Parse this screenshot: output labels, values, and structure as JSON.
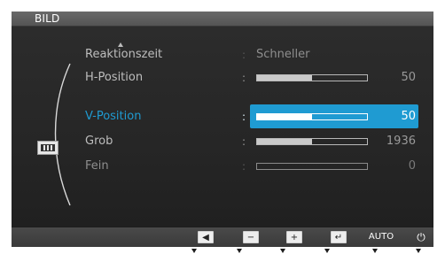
{
  "osd": {
    "title": "BILD",
    "category_icon": "picture-icon",
    "items": [
      {
        "label": "Reaktionszeit",
        "colon": ":",
        "text_value": "Schneller",
        "dimmed": true
      },
      {
        "label": "H-Position",
        "colon": ":",
        "value": "50",
        "level": 0.5,
        "dimmed": false
      },
      {
        "label": "V-Position",
        "colon": ":",
        "value": "50",
        "level": 0.5,
        "selected": true
      },
      {
        "label": "Grob",
        "colon": ":",
        "value": "1936",
        "level": 0.5,
        "dimmed": false
      },
      {
        "label": "Fein",
        "colon": ":",
        "value": "0",
        "level": 0.0,
        "dimmed": true
      }
    ],
    "buttons": [
      {
        "name": "left-button",
        "icon": "arrow-left-icon",
        "glyph": "◀"
      },
      {
        "name": "minus-button",
        "icon": "minus-icon",
        "glyph": "−"
      },
      {
        "name": "plus-button",
        "icon": "plus-icon",
        "glyph": "+"
      },
      {
        "name": "enter-button",
        "icon": "enter-icon",
        "glyph": "↵"
      },
      {
        "name": "auto-button",
        "icon": "",
        "glyph": "AUTO"
      },
      {
        "name": "power-button",
        "icon": "power-icon",
        "glyph": "⏻"
      }
    ],
    "colors": {
      "accent": "#1f9bd2",
      "background": "#1d1d1d",
      "text": "#bdbdbd"
    }
  }
}
